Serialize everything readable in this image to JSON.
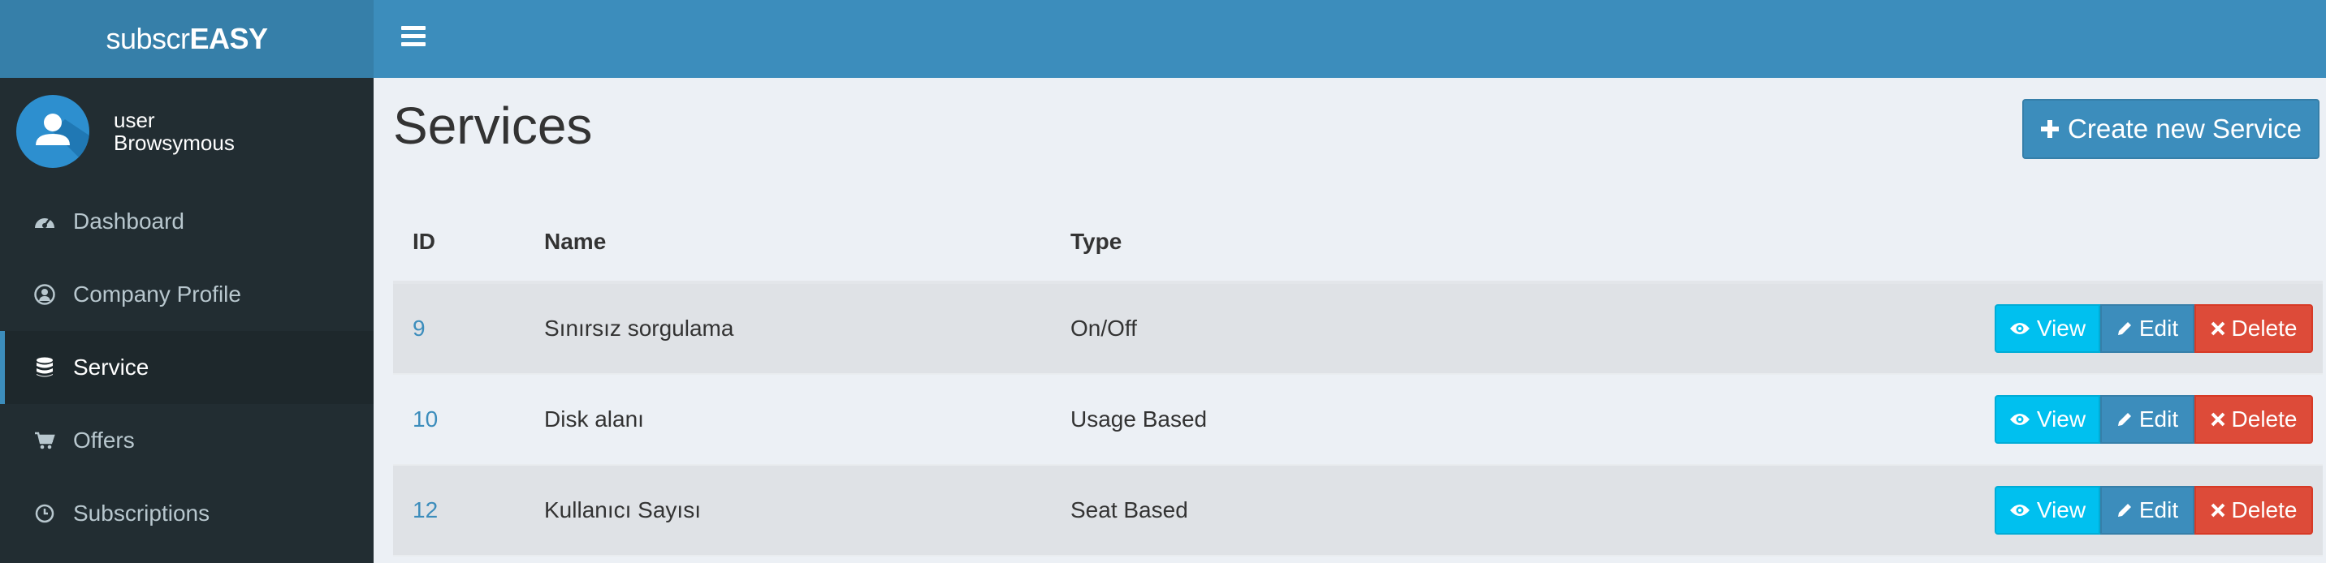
{
  "app": {
    "logo_light": "subscr",
    "logo_bold": "EASY"
  },
  "user": {
    "line1": "user",
    "line2": "Browsymous"
  },
  "sidebar": {
    "items": [
      {
        "label": "Dashboard",
        "icon": "dashboard-icon"
      },
      {
        "label": "Company Profile",
        "icon": "user-circle-icon"
      },
      {
        "label": "Service",
        "icon": "database-icon",
        "active": true
      },
      {
        "label": "Offers",
        "icon": "cart-icon"
      },
      {
        "label": "Subscriptions",
        "icon": "clock-icon"
      }
    ]
  },
  "header": {
    "menu_icon": "hamburger-icon"
  },
  "page": {
    "title": "Services",
    "create_label": "Create new Service",
    "create_icon": "plus-icon"
  },
  "table": {
    "headers": {
      "id": "ID",
      "name": "Name",
      "type": "Type"
    },
    "rows": [
      {
        "id": "9",
        "name": "Sınırsız sorgulama",
        "type": "On/Off"
      },
      {
        "id": "10",
        "name": "Disk alanı",
        "type": "Usage Based"
      },
      {
        "id": "12",
        "name": "Kullanıcı Sayısı",
        "type": "Seat Based"
      }
    ],
    "actions": {
      "view": "View",
      "edit": "Edit",
      "delete": "Delete"
    }
  },
  "colors": {
    "brand": "#3c8dbc",
    "sidebar": "#222d32",
    "view": "#00c0ef",
    "delete": "#dd4b39"
  }
}
